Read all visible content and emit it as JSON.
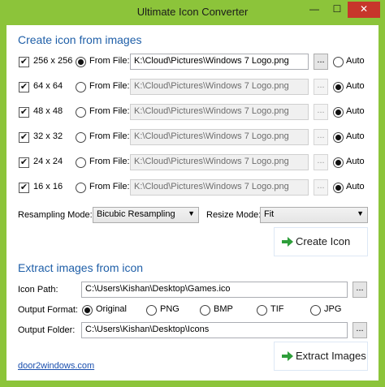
{
  "window": {
    "title": "Ultimate Icon Converter",
    "controls": {
      "minimize": "—",
      "maximize": "☐",
      "close": "✕"
    }
  },
  "create": {
    "section_title": "Create icon from images",
    "rows": [
      {
        "size": "256 x 256",
        "checked": true,
        "source_label": "From File:",
        "path": "K:\\Cloud\\Pictures\\Windows 7 Logo.png",
        "browse": "...",
        "auto_label": "Auto",
        "mode": "file"
      },
      {
        "size": "64 x 64",
        "checked": true,
        "source_label": "From File:",
        "path": "K:\\Cloud\\Pictures\\Windows 7 Logo.png",
        "browse": "...",
        "auto_label": "Auto",
        "mode": "auto"
      },
      {
        "size": "48 x 48",
        "checked": true,
        "source_label": "From File:",
        "path": "K:\\Cloud\\Pictures\\Windows 7 Logo.png",
        "browse": "...",
        "auto_label": "Auto",
        "mode": "auto"
      },
      {
        "size": "32 x 32",
        "checked": true,
        "source_label": "From File:",
        "path": "K:\\Cloud\\Pictures\\Windows 7 Logo.png",
        "browse": "...",
        "auto_label": "Auto",
        "mode": "auto"
      },
      {
        "size": "24 x 24",
        "checked": true,
        "source_label": "From File:",
        "path": "K:\\Cloud\\Pictures\\Windows 7 Logo.png",
        "browse": "...",
        "auto_label": "Auto",
        "mode": "auto"
      },
      {
        "size": "16 x 16",
        "checked": true,
        "source_label": "From File:",
        "path": "K:\\Cloud\\Pictures\\Windows 7 Logo.png",
        "browse": "...",
        "auto_label": "Auto",
        "mode": "auto"
      }
    ],
    "resampling_label": "Resampling Mode:",
    "resampling_value": "Bicubic Resampling",
    "resize_label": "Resize Mode:",
    "resize_value": "Fit",
    "create_button": "Create Icon"
  },
  "extract": {
    "section_title": "Extract images from icon",
    "icon_path_label": "Icon Path:",
    "icon_path_value": "C:\\Users\\Kishan\\Desktop\\Games.ico",
    "output_format_label": "Output Format:",
    "formats": [
      {
        "label": "Original",
        "selected": true
      },
      {
        "label": "PNG",
        "selected": false
      },
      {
        "label": "BMP",
        "selected": false
      },
      {
        "label": "TIF",
        "selected": false
      },
      {
        "label": "JPG",
        "selected": false
      }
    ],
    "output_folder_label": "Output Folder:",
    "output_folder_value": "C:\\Users\\Kishan\\Desktop\\Icons",
    "browse": "...",
    "extract_button": "Extract Images"
  },
  "footer_link": "door2windows.com",
  "colors": {
    "frame": "#8cc43a",
    "accent_title": "#1f5fa8",
    "close": "#c7362b",
    "arrow": "#2e9e3a",
    "link": "#1a4fae"
  },
  "icons": {
    "button_arrow": "green-arrow-right-icon",
    "checkbox_check": "check-icon",
    "dropdown": "chevron-down-icon"
  }
}
